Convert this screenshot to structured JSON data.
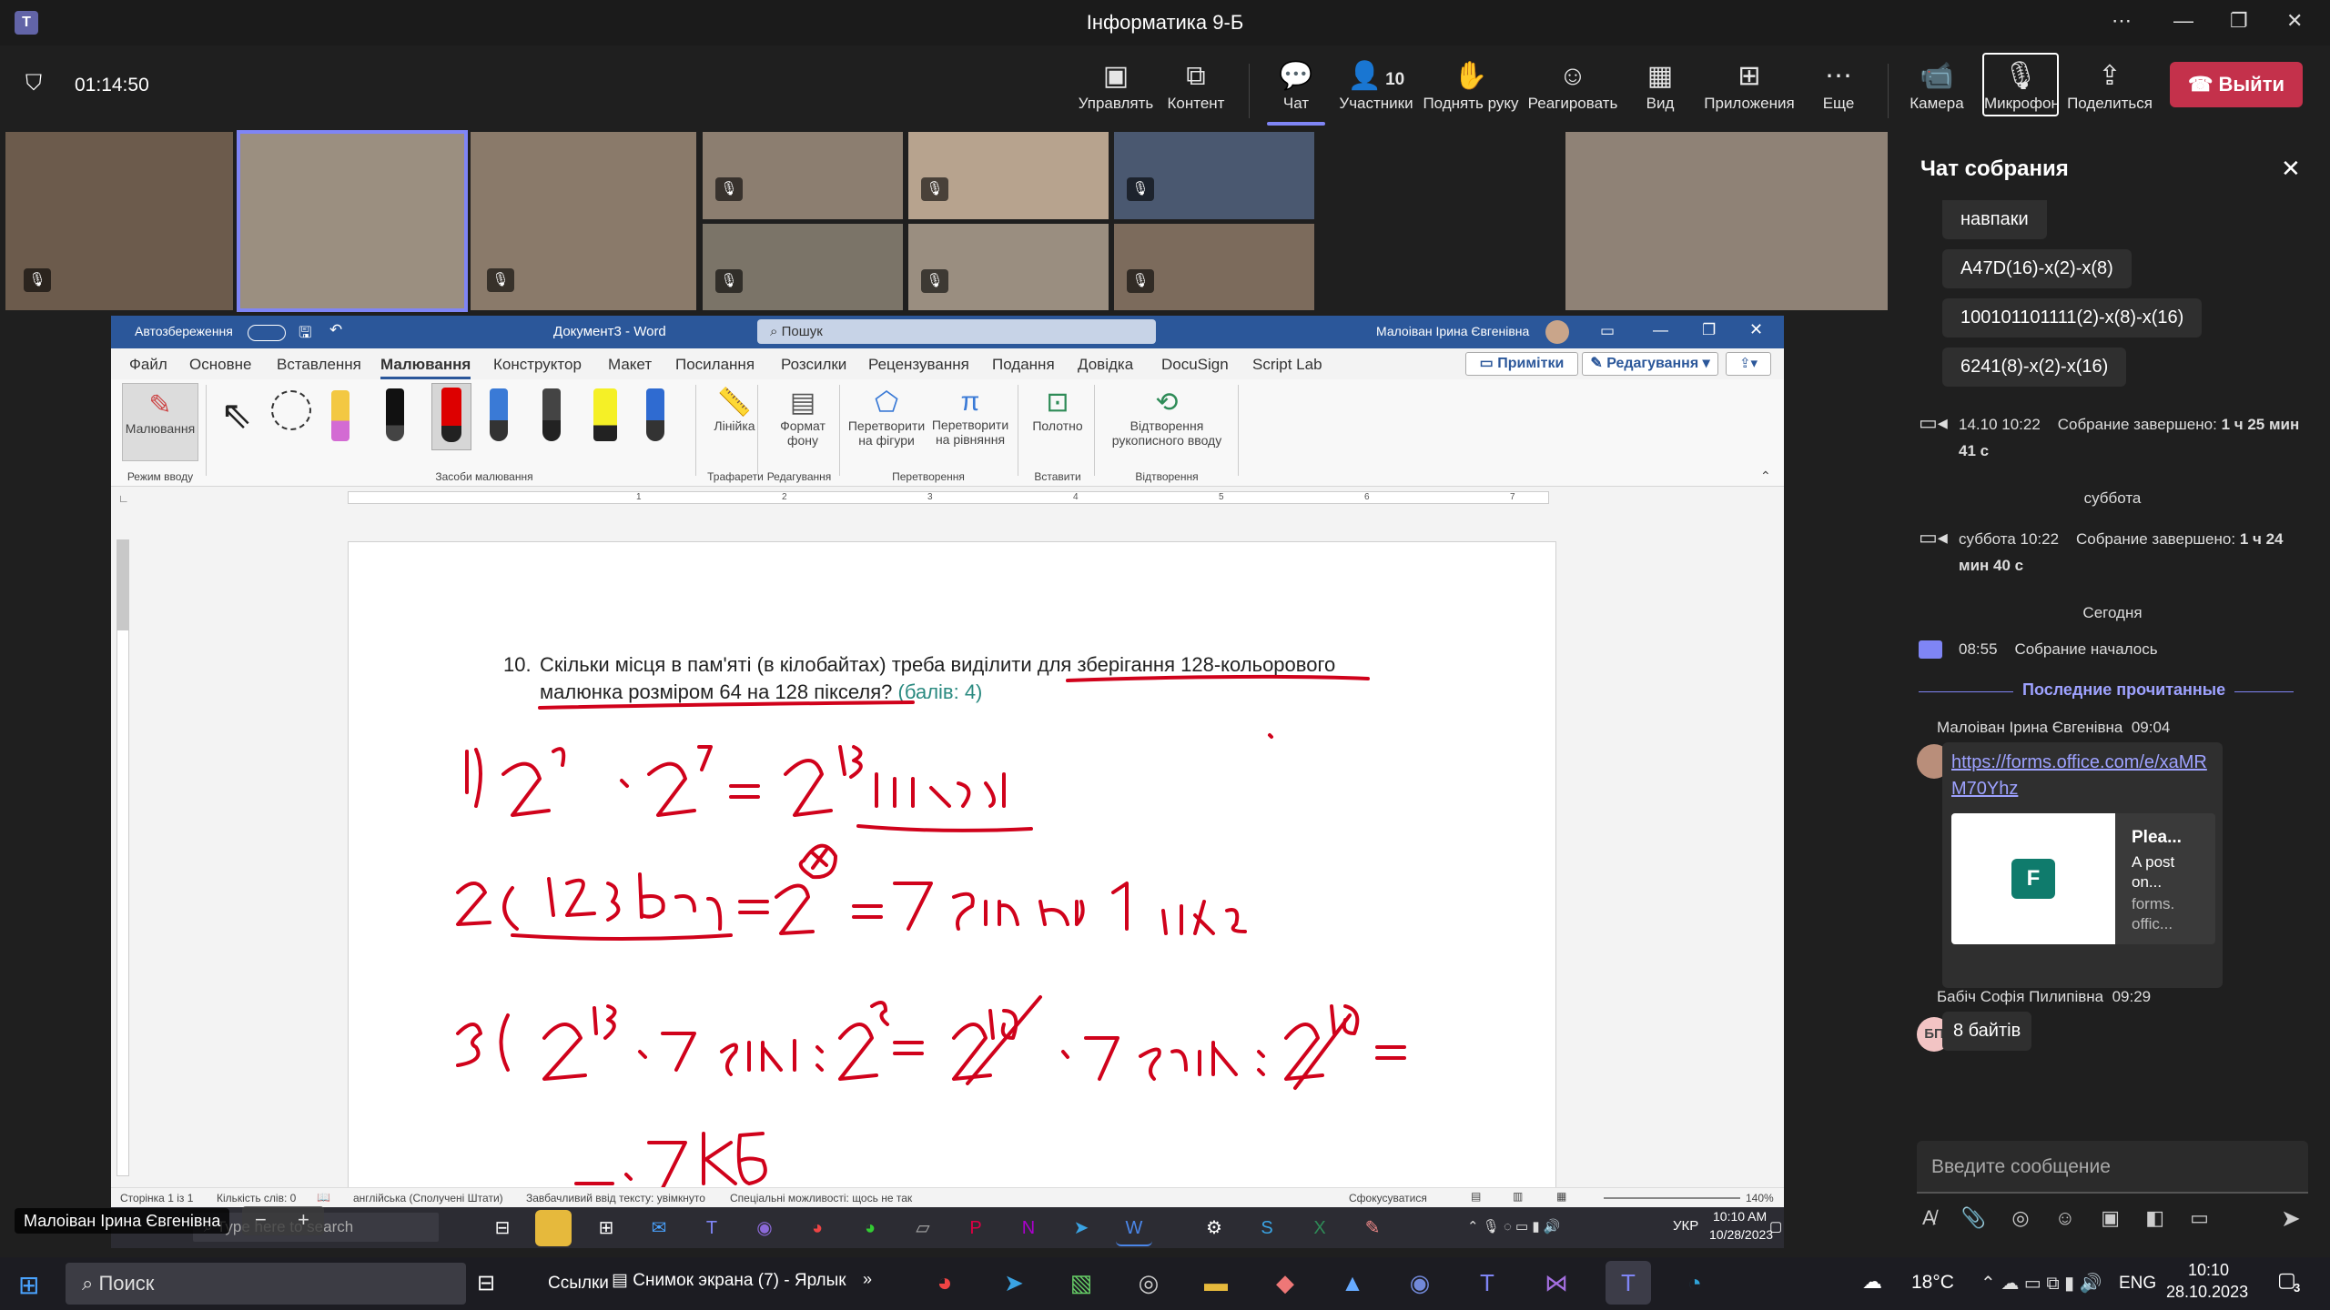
{
  "app_title": "Інформатика 9-Б",
  "meeting": {
    "timer": "01:14:50",
    "tools": [
      {
        "label": "Управлять",
        "icon": "manage-icon",
        "glyph": "▣"
      },
      {
        "label": "Контент",
        "icon": "content-icon",
        "glyph": "⧉"
      },
      {
        "label": "Чат",
        "icon": "chat-icon",
        "glyph": "💬"
      },
      {
        "label": "Участники",
        "icon": "people-icon",
        "glyph": "👤"
      },
      {
        "label": "Поднять руку",
        "icon": "raise-hand-icon",
        "glyph": "✋"
      },
      {
        "label": "Реагировать",
        "icon": "react-icon",
        "glyph": "☺"
      },
      {
        "label": "Вид",
        "icon": "view-icon",
        "glyph": "▦"
      },
      {
        "label": "Приложения",
        "icon": "apps-icon",
        "glyph": "⊞"
      },
      {
        "label": "Еще",
        "icon": "more-icon",
        "glyph": "⋯"
      },
      {
        "label": "Камера",
        "icon": "camera-icon",
        "glyph": "📹"
      },
      {
        "label": "Микрофон",
        "icon": "microphone-off-icon",
        "glyph": "🎙"
      },
      {
        "label": "Поделиться",
        "icon": "share-icon",
        "glyph": "⇪"
      }
    ],
    "participants_count": "10",
    "leave_label": "Выйти",
    "presenter_name": "Малоіван Ірина Євгенівна"
  },
  "word": {
    "autosave": "Автозбереження",
    "doc_title": "Документ3 - Word",
    "search": "Пошук",
    "user": "Малоіван Ірина Євгенівна",
    "menu": [
      "Файл",
      "Основне",
      "Вставлення",
      "Малювання",
      "Конструктор",
      "Макет",
      "Посилання",
      "Розсилки",
      "Рецензування",
      "Подання",
      "Довідка",
      "DocuSign",
      "Script Lab"
    ],
    "notes": "Примітки",
    "editing": "Редагування",
    "ribbon": {
      "draw": "Малювання",
      "input_mode": "Режим вводу",
      "tools_group": "Засоби малювання",
      "ruler": "Лінійка",
      "stencils": "Трафарети",
      "bg_format_1": "Формат",
      "bg_format_2": "фону",
      "edit_group": "Редагування",
      "to_shapes_1": "Перетворити",
      "to_shapes_2": "на фігури",
      "to_math_1": "Перетворити",
      "to_math_2": "на рівняння",
      "convert_group": "Перетворення",
      "canvas": "Полотно",
      "insert_group": "Вставити",
      "replay_1": "Відтворення",
      "replay_2": "рукописного вводу",
      "replay_group": "Відтворення"
    },
    "ruler_nums": [
      "1",
      "2",
      "3",
      "4",
      "5",
      "6",
      "7"
    ],
    "question_num": "10.",
    "question_line1": "Скільки місця в пам'яті (в кілобайтах) треба виділити для зберігання 128-кольорового",
    "question_line2": "малюнка розміром 64 на 128 пікселя?",
    "question_points": "(балів: 4)",
    "status": {
      "page": "Сторінка 1 із 1",
      "words": "Кількість слів: 0",
      "lang": "англійська (Сполучені Штати)",
      "predict": "Завбачливий ввід тексту: увімкнуто",
      "access": "Спеціальні можливості: щось не так",
      "focus": "Сфокусуватися",
      "zoom": "140%"
    }
  },
  "inner_taskbar": {
    "search_placeholder": "Type here to search",
    "lang": "УКР",
    "time": "10:10 AM",
    "date": "10/28/2023"
  },
  "chat": {
    "title": "Чат собрания",
    "messages_top": [
      "навпаки",
      "A47D(16)-x(2)-x(8)",
      "100101101111(2)-x(8)-x(16)",
      "6241(8)-x(2)-x(16)"
    ],
    "event1_time": "14.10 10:22",
    "event1_text": "Собрание завершено:",
    "event1_dur": "1 ч 25 мин 41 с",
    "day1": "суббота",
    "event2_time": "суббота 10:22",
    "event2_text": "Собрание завершено:",
    "event2_dur": "1 ч 24 мин 40 с",
    "day2": "Сегодня",
    "event3_time": "08:55",
    "event3_text": "Собрание началось",
    "last_read": "Последние прочитанные",
    "msg1_author": "Малоіван Ірина Євгенівна",
    "msg1_time": "09:04",
    "msg1_link": "https://forms.office.com/e/xaMRM70Yhz",
    "card_title": "Plea...",
    "card_l1": "A post",
    "card_l2": "on...",
    "card_l3": "forms.",
    "card_l4": "offic...",
    "msg2_author": "Бабіч Софія Пилипівна",
    "msg2_time": "09:29",
    "msg2_initials": "БП",
    "msg2_text": "8 байтів",
    "compose_placeholder": "Введите сообщение"
  },
  "taskbar": {
    "search": "Поиск",
    "links": "Ссылки",
    "snapshot": "Снимок экрана (7) - Ярлык",
    "weather": "18°C",
    "lang": "ENG",
    "time": "10:10",
    "date": "28.10.2023",
    "notif_count": "3"
  },
  "colors": {
    "accent": "#6264a7",
    "leave": "#c4314b",
    "word_blue": "#2b579a",
    "ink": "#d0021b"
  }
}
